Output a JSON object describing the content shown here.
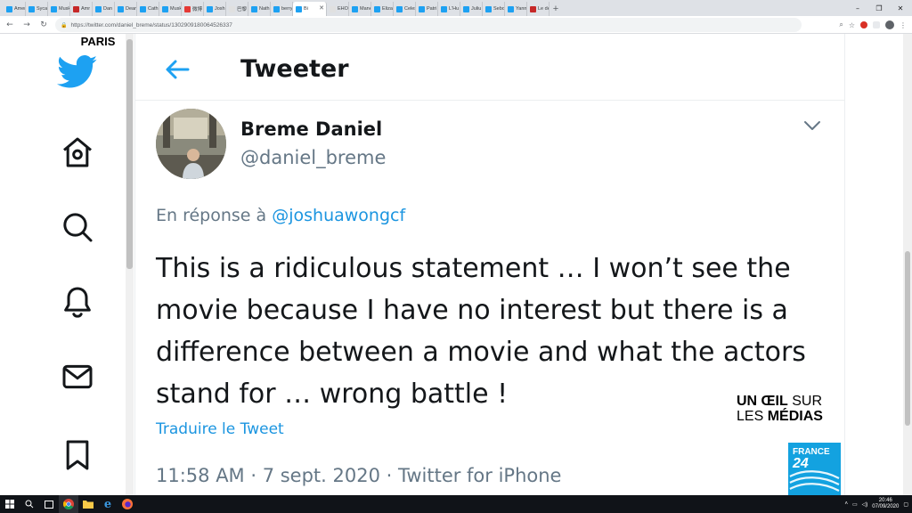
{
  "browser": {
    "tabs": [
      {
        "label": "Amer",
        "color": "#1da1f2"
      },
      {
        "label": "Sycar",
        "color": "#1da1f2"
      },
      {
        "label": "Musk",
        "color": "#1da1f2"
      },
      {
        "label": "Amr",
        "color": "#c62828"
      },
      {
        "label": "Dan",
        "color": "#1da1f2"
      },
      {
        "label": "Dean",
        "color": "#1da1f2"
      },
      {
        "label": "Cath",
        "color": "#1da1f2"
      },
      {
        "label": "Musk",
        "color": "#1da1f2"
      },
      {
        "label": "微博",
        "color": "#e53935"
      },
      {
        "label": "Josh",
        "color": "#1da1f2"
      },
      {
        "label": "巴黎",
        "color": "#e0e0e0"
      },
      {
        "label": "Nath",
        "color": "#1da1f2"
      },
      {
        "label": "berry",
        "color": "#1da1f2"
      },
      {
        "label": "Bi",
        "color": "#1da1f2",
        "active": true
      },
      {
        "label": "EHOr",
        "color": "#e0e0e0"
      },
      {
        "label": "Mane",
        "color": "#1da1f2"
      },
      {
        "label": "Eliza",
        "color": "#1da1f2"
      },
      {
        "label": "Celes",
        "color": "#1da1f2"
      },
      {
        "label": "Patri",
        "color": "#1da1f2"
      },
      {
        "label": "L'Hu",
        "color": "#1da1f2"
      },
      {
        "label": "Juliu",
        "color": "#1da1f2"
      },
      {
        "label": "Sebo",
        "color": "#1da1f2"
      },
      {
        "label": "Yann",
        "color": "#1da1f2"
      },
      {
        "label": "Le de",
        "color": "#c62828"
      }
    ],
    "url": "https://twitter.com/daniel_breme/status/1302909180064526337"
  },
  "overlay": {
    "location": "PARIS",
    "segment_line1_bold": "UN ŒIL",
    "segment_line1_rest": " SUR",
    "segment_line2_rest": "LES ",
    "segment_line2_bold": "MÉDIAS",
    "channel_name": "FRANCE",
    "channel_number": "24"
  },
  "header": {
    "title": "Tweeter"
  },
  "tweet": {
    "author_name": "Breme Daniel",
    "author_handle": "@daniel_breme",
    "reply_prefix": "En réponse à ",
    "reply_mention": "@joshuawongcf",
    "text": "This is a ridiculous statement … I won’t see the movie because I have no interest but there is a difference between a movie and what the actors stand for … wrong battle !",
    "translate_label": "Traduire le Tweet",
    "meta": "11:58 AM · 7 sept. 2020 · Twitter for iPhone"
  },
  "taskbar": {
    "time": "20:46",
    "date": "07/09/2020"
  },
  "colors": {
    "twitter_blue": "#1da1f2",
    "link_blue": "#1b95e0",
    "secondary_text": "#657786",
    "france24_blue": "#13a2e0"
  }
}
